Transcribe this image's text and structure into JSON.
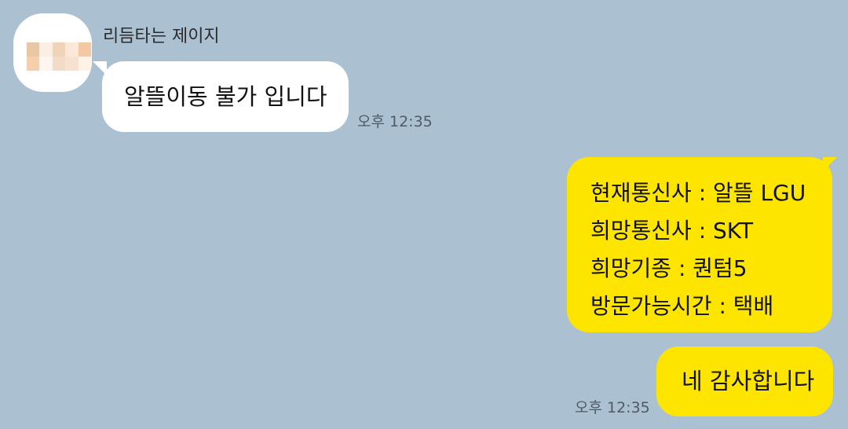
{
  "chat": {
    "incoming": {
      "sender_name": "리듬타는 제이지",
      "message": "알뜰이동 불가 입니다",
      "time": "오후 12:35",
      "avatar_pixels": [
        "#e9c7a4",
        "#fbeee2",
        "#f0d4b8",
        "#fce8d8",
        "#f3c9a3",
        "#f5cfac",
        "#fdf5ee",
        "#f2dcc7",
        "#f8e2cf",
        "#fff3e6"
      ]
    },
    "outgoing": [
      {
        "lines": [
          "현재통신사 : 알뜰 LGU",
          "희망통신사 : SKT",
          "희망기종 : 퀀텀5",
          "방문가능시간 : 택배"
        ]
      },
      {
        "message": "네 감사합니다",
        "time": "오후 12:35"
      }
    ]
  },
  "colors": {
    "background": "#abc1d1",
    "incoming_bubble": "#ffffff",
    "outgoing_bubble": "#fee500"
  }
}
